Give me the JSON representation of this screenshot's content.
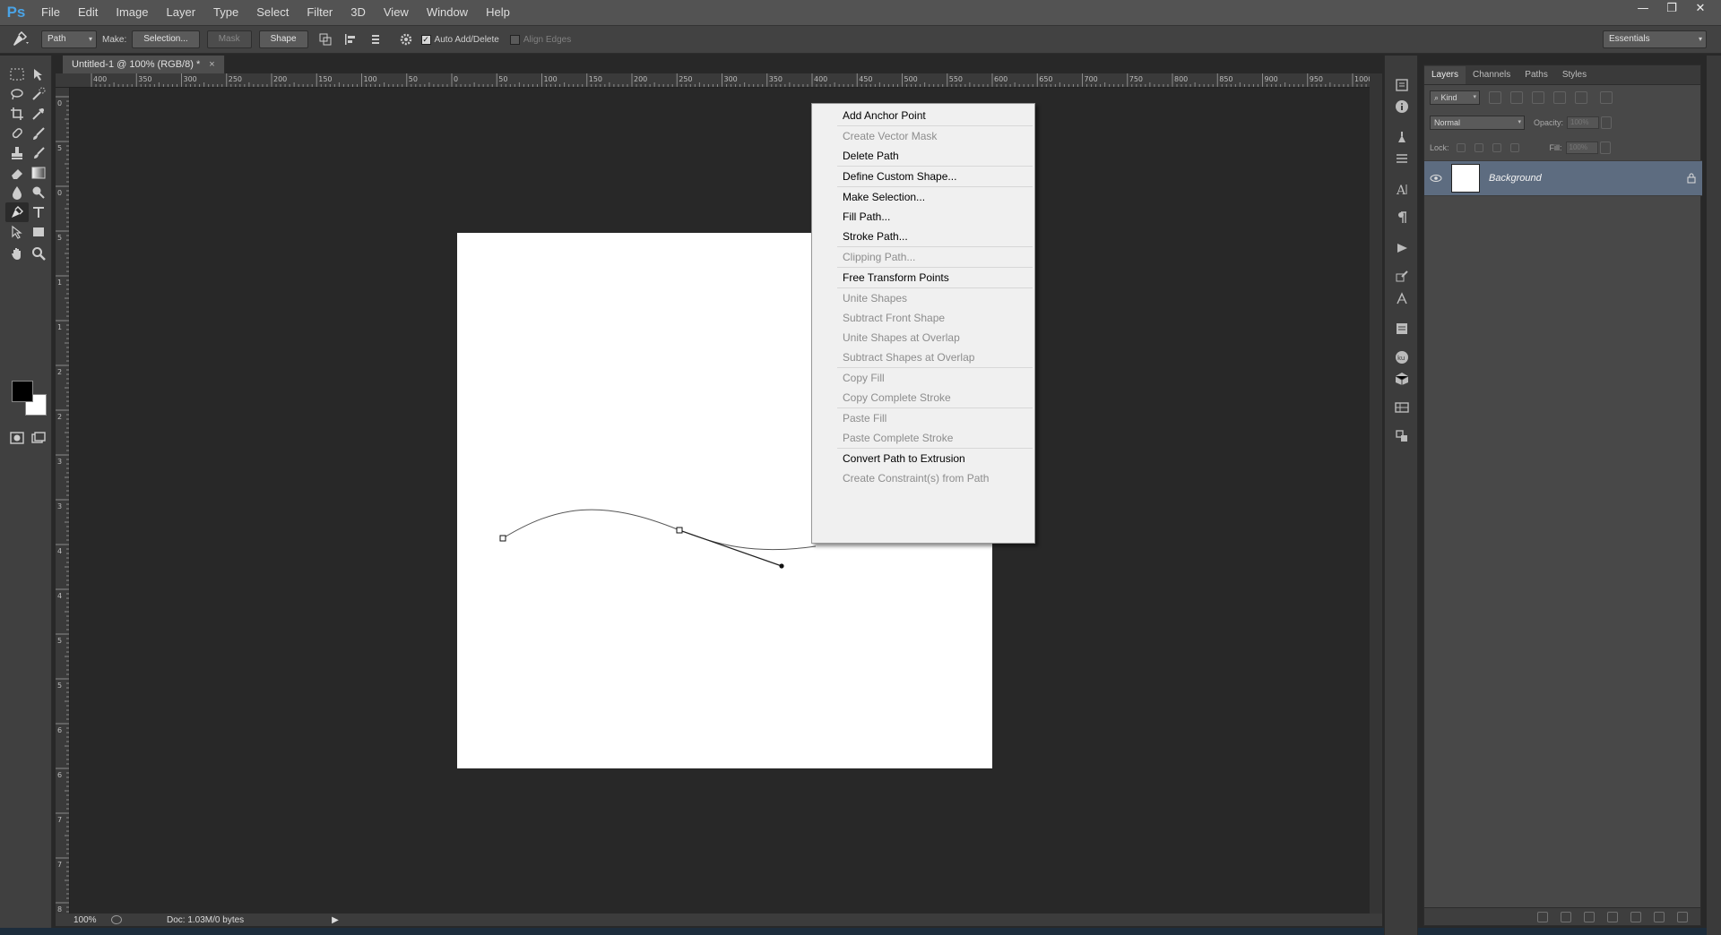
{
  "app": {
    "logo": "Ps",
    "menu": [
      "File",
      "Edit",
      "Image",
      "Layer",
      "Type",
      "Select",
      "Filter",
      "3D",
      "View",
      "Window",
      "Help"
    ],
    "window_controls": [
      "minimize",
      "restore",
      "close"
    ]
  },
  "options_bar": {
    "tool_icon": "pen-icon",
    "path_mode": "Path",
    "make_label": "Make:",
    "selection_btn": "Selection...",
    "mask_btn": "Mask",
    "shape_btn": "Shape",
    "auto_add_delete": "Auto Add/Delete",
    "auto_add_delete_checked": true,
    "align_edges": "Align Edges",
    "align_edges_checked": false,
    "workspace": "Essentials"
  },
  "document": {
    "tab_title": "Untitled-1 @ 100% (RGB/8) *",
    "zoom": "100%",
    "doc_info": "Doc: 1.03M/0 bytes",
    "ruler_h_labels": [
      "400",
      "350",
      "300",
      "250",
      "200",
      "150",
      "100",
      "50",
      "0",
      "50",
      "100",
      "150",
      "200",
      "250",
      "300",
      "350",
      "400",
      "450",
      "500",
      "550",
      "600",
      "650",
      "700",
      "750",
      "800",
      "850",
      "900",
      "950",
      "1000"
    ],
    "ruler_v_labels": [
      "0",
      "5",
      "0",
      "5",
      "1",
      "1",
      "2",
      "2",
      "3",
      "3",
      "4",
      "4",
      "5",
      "5",
      "6",
      "6",
      "7",
      "7",
      "8",
      "8"
    ]
  },
  "context_menu": {
    "items": [
      {
        "label": "Add Anchor Point",
        "enabled": true
      },
      {
        "sep": true
      },
      {
        "label": "Create Vector Mask",
        "enabled": false
      },
      {
        "label": "Delete Path",
        "enabled": true
      },
      {
        "sep": true
      },
      {
        "label": "Define Custom Shape...",
        "enabled": true
      },
      {
        "sep": true
      },
      {
        "label": "Make Selection...",
        "enabled": true
      },
      {
        "label": "Fill Path...",
        "enabled": true
      },
      {
        "label": "Stroke Path...",
        "enabled": true
      },
      {
        "sep": true
      },
      {
        "label": "Clipping Path...",
        "enabled": false
      },
      {
        "sep": true
      },
      {
        "label": "Free Transform Points",
        "enabled": true
      },
      {
        "sep": true
      },
      {
        "label": "Unite Shapes",
        "enabled": false
      },
      {
        "label": "Subtract Front Shape",
        "enabled": false
      },
      {
        "label": "Unite Shapes at Overlap",
        "enabled": false
      },
      {
        "label": "Subtract Shapes at Overlap",
        "enabled": false
      },
      {
        "sep": true
      },
      {
        "label": "Copy Fill",
        "enabled": false
      },
      {
        "label": "Copy Complete Stroke",
        "enabled": false
      },
      {
        "sep": true
      },
      {
        "label": "Paste Fill",
        "enabled": false
      },
      {
        "label": "Paste Complete Stroke",
        "enabled": false
      },
      {
        "sep": true
      },
      {
        "label": "Convert Path to Extrusion",
        "enabled": true
      },
      {
        "label": "Create Constraint(s) from Path",
        "enabled": false
      }
    ]
  },
  "layers_panel": {
    "tabs": [
      "Layers",
      "Channels",
      "Paths",
      "Styles"
    ],
    "active_tab": "Layers",
    "kind_filter": "Kind",
    "blend_mode": "Normal",
    "opacity_label": "Opacity:",
    "opacity_value": "100%",
    "lock_label": "Lock:",
    "fill_label": "Fill:",
    "fill_value": "100%",
    "layers": [
      {
        "name": "Background",
        "visible": true,
        "locked": true
      }
    ]
  },
  "colors": {
    "accent": "#4aa3e6",
    "selected_layer": "#5d6c80",
    "canvas": "#ffffff",
    "workspace_bg": "#282828"
  }
}
